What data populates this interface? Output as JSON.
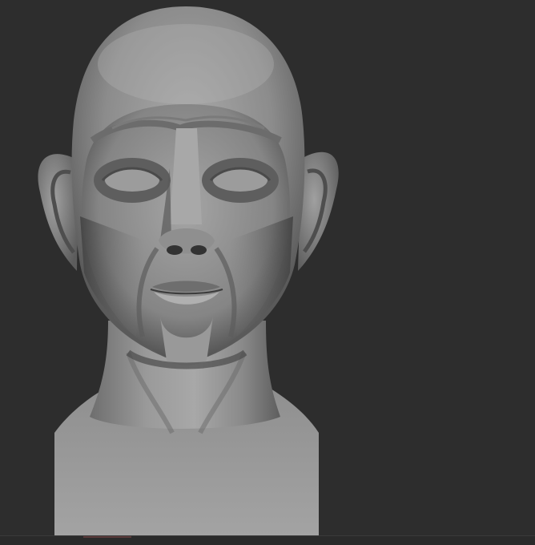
{
  "app": {
    "kind": "3d-sculpt-viewport",
    "background_color": "#2d2d2d"
  },
  "viewport": {
    "subject": "sculpted-head-bust",
    "material_color": "#8a8a8a",
    "shading": "matcap-grey"
  },
  "bottom_bar": {
    "marker_color": "#5a3a3a"
  }
}
